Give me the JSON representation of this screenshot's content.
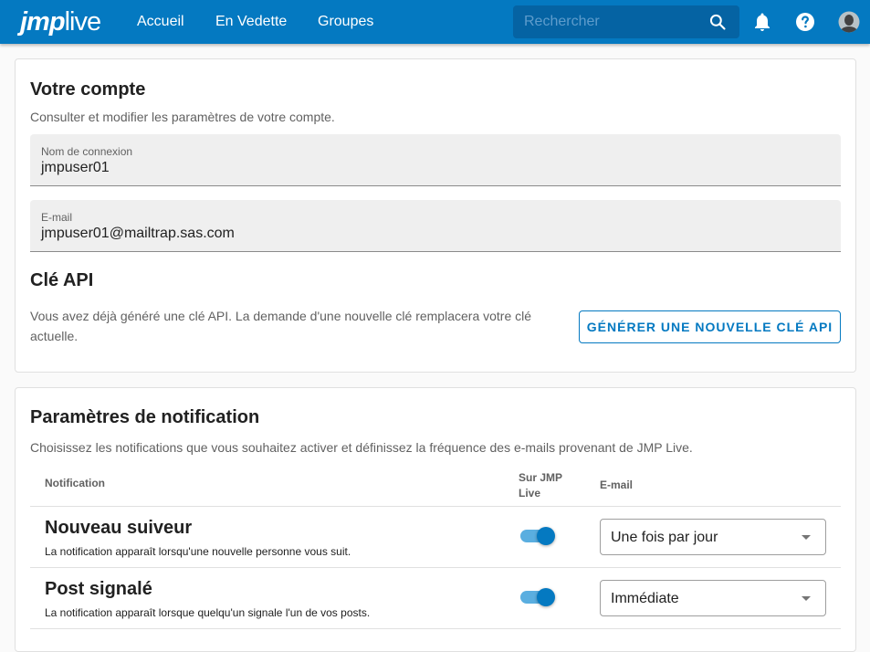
{
  "header": {
    "logo_jmp": "jmp",
    "logo_live": "live",
    "nav": [
      {
        "label": "Accueil"
      },
      {
        "label": "En Vedette"
      },
      {
        "label": "Groupes"
      }
    ],
    "search": {
      "placeholder": "Rechercher",
      "value": ""
    },
    "icons": [
      "search-icon",
      "bell-icon",
      "help-icon",
      "avatar-icon"
    ]
  },
  "account": {
    "title": "Votre compte",
    "subtitle": "Consulter et modifier les paramètres de votre compte.",
    "username": {
      "label": "Nom de connexion",
      "value": "jmpuser01"
    },
    "email": {
      "label": "E-mail",
      "value": "jmpuser01@mailtrap.sas.com"
    },
    "api": {
      "title": "Clé API",
      "description_line1": "Vous avez déjà généré une clé API. La demande d'une nouvelle clé remplacera votre clé",
      "description_line2": "actuelle.",
      "button_label": "GÉNÉRER UNE NOUVELLE CLÉ API"
    }
  },
  "notifications": {
    "title": "Paramètres de notification",
    "subtitle": "Choisissez les notifications que vous souhaitez activer et définissez la fréquence des e-mails provenant de JMP Live.",
    "columns": {
      "notification": "Notification",
      "on_site_line1": "Sur JMP",
      "on_site_line2": "Live",
      "email": "E-mail"
    },
    "rows": [
      {
        "title": "Nouveau suiveur",
        "description": "La notification apparaît lorsqu'une nouvelle personne vous suit.",
        "on_site": true,
        "email": "Une fois par jour"
      },
      {
        "title": "Post signalé",
        "description": "La notification apparaît lorsque quelqu'un signale l'un de vos posts.",
        "on_site": true,
        "email": "Immédiate"
      }
    ]
  },
  "colors": {
    "brand": "#0479c1",
    "toggle_track": "#5aaee0"
  }
}
